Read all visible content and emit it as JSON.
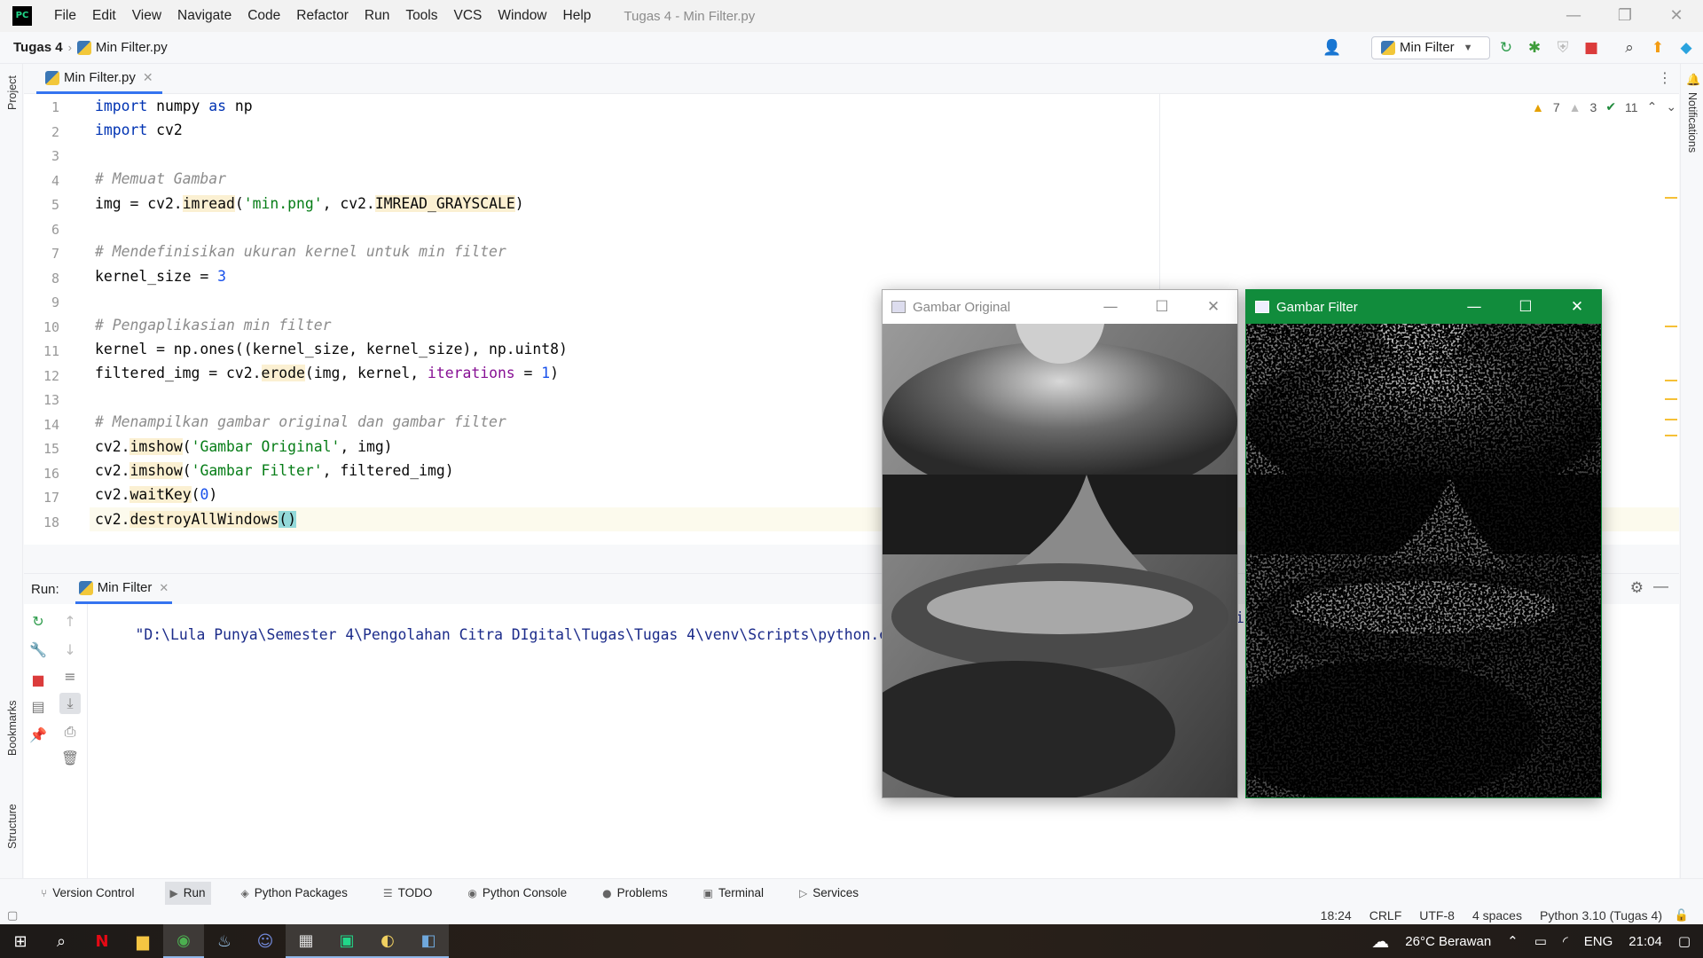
{
  "app": {
    "logo_text": "PC",
    "menu": [
      "File",
      "Edit",
      "View",
      "Navigate",
      "Code",
      "Refactor",
      "Run",
      "Tools",
      "VCS",
      "Window",
      "Help"
    ],
    "window_title": "Tugas 4 - Min Filter.py",
    "minimize": "—",
    "maximize": "❐",
    "close": "✕"
  },
  "navbar": {
    "project": "Tugas 4",
    "file": "Min Filter.py",
    "run_config": "Min Filter"
  },
  "left_strip": {
    "project": "Project",
    "bookmarks": "Bookmarks",
    "structure": "Structure"
  },
  "right_strip": {
    "notifications": "Notifications"
  },
  "editor": {
    "tab_label": "Min Filter.py",
    "line_numbers": [
      "1",
      "2",
      "3",
      "4",
      "5",
      "6",
      "7",
      "8",
      "9",
      "10",
      "11",
      "12",
      "13",
      "14",
      "15",
      "16",
      "17",
      "18"
    ],
    "inspections": {
      "warnings": "7",
      "weak_warnings": "3",
      "ok": "11"
    },
    "tokens": {
      "import": "import",
      "as": "as",
      "numpy": " numpy ",
      "np": " np",
      "cv2": " cv2",
      "c1": "# Memuat Gambar",
      "l5a": "img = cv2.",
      "imread": "imread",
      "l5b": "(",
      "s_min": "'min.png'",
      "l5c": ", cv2.",
      "gray": "IMREAD_GRAYSCALE",
      "l5d": ")",
      "c2": "# Mendefinisikan ukuran kernel untuk min filter",
      "l8a": "kernel_size = ",
      "n3": "3",
      "c3": "# Pengaplikasian min filter",
      "l11": "kernel = np.ones((kernel_size, kernel_size), np.uint8)",
      "l12a": "filtered_img = cv2.",
      "erode": "erode",
      "l12b": "(img, kernel, ",
      "iter": "iterations",
      "l12c": " = ",
      "n1": "1",
      "l12d": ")",
      "c4": "# Menampilkan gambar original dan gambar filter",
      "cv2dot": "cv2.",
      "imshow": "imshow",
      "lp": "(",
      "s_go": "'Gambar Original'",
      "l15b": ", img)",
      "s_gf": "'Gambar Filter'",
      "l16b": ", filtered_img)",
      "waitkey": "waitKey",
      "n0": "0",
      "rp": ")",
      "destroy": "destroyAllWindows",
      "parens": "()"
    }
  },
  "run_panel": {
    "label": "Run:",
    "tab": "Min Filter",
    "output": "\"D:\\Lula Punya\\Semester 4\\Pengolahan Citra DIgital\\Tugas\\Tugas 4\\venv\\Scripts\\python.exe\"",
    "output_tail": "i"
  },
  "windows": [
    {
      "title": "Gambar Original",
      "active": false
    },
    {
      "title": "Gambar Filter",
      "active": true
    }
  ],
  "bottom_bar": [
    "Version Control",
    "Run",
    "Python Packages",
    "TODO",
    "Python Console",
    "Problems",
    "Terminal",
    "Services"
  ],
  "status_bar": {
    "position": "18:24",
    "line_sep": "CRLF",
    "encoding": "UTF-8",
    "indent": "4 spaces",
    "interpreter": "Python 3.10 (Tugas 4)"
  },
  "taskbar": {
    "weather": "26°C  Berawan",
    "lang": "ENG",
    "time": "21:04"
  },
  "colors": {
    "accent": "#3574f0",
    "active_window": "#118c3c"
  }
}
